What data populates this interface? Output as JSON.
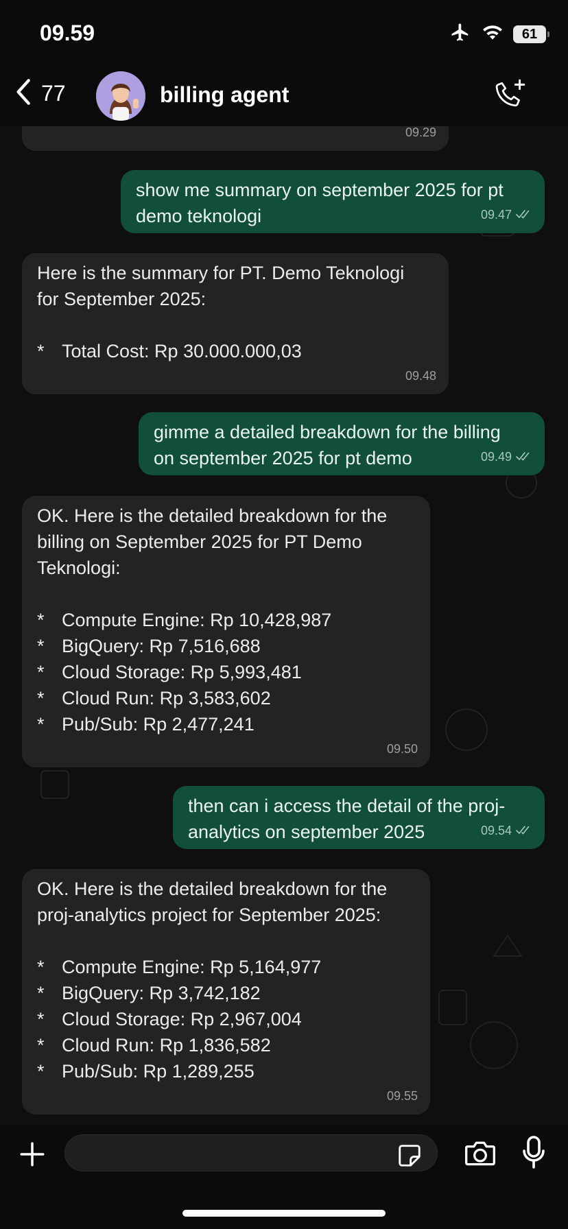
{
  "status": {
    "time": "09.59",
    "battery": "61"
  },
  "header": {
    "back_count": "77",
    "contact_name": "billing agent"
  },
  "messages": [
    {
      "dir": "in",
      "lines": [],
      "time": "09.29"
    },
    {
      "dir": "out",
      "lines": [
        "show me summary on september 2025 for pt",
        "demo teknologi"
      ],
      "time": "09.47"
    },
    {
      "dir": "in",
      "lines": [
        "Here is the summary for PT. Demo Teknologi",
        "for September 2025:",
        "",
        "*   Total Cost: Rp 30.000.000,03"
      ],
      "time": "09.48"
    },
    {
      "dir": "out",
      "lines": [
        "gimme a detailed breakdown for the billing",
        "on september 2025 for pt demo"
      ],
      "time": "09.49"
    },
    {
      "dir": "in",
      "lines": [
        "OK. Here is the detailed breakdown for the",
        "billing on September 2025 for PT Demo",
        "Teknologi:",
        "",
        "*   Compute Engine: Rp 10,428,987",
        "*   BigQuery: Rp 7,516,688",
        "*   Cloud Storage: Rp 5,993,481",
        "*   Cloud Run: Rp 3,583,602",
        "*   Pub/Sub: Rp 2,477,241"
      ],
      "time": "09.50"
    },
    {
      "dir": "out",
      "lines": [
        "then can i access the detail of the proj-",
        "analytics on september 2025"
      ],
      "time": "09.54"
    },
    {
      "dir": "in",
      "lines": [
        "OK. Here is the detailed breakdown for the",
        "proj-analytics project for September 2025:",
        "",
        "*   Compute Engine: Rp 5,164,977",
        "*   BigQuery: Rp 3,742,182",
        "*   Cloud Storage: Rp 2,967,004",
        "*   Cloud Run: Rp 1,836,582",
        "*   Pub/Sub: Rp 1,289,255"
      ],
      "time": "09.55"
    }
  ],
  "input": {
    "placeholder": ""
  },
  "icons": {
    "airplane": "airplane-icon",
    "wifi": "wifi-icon",
    "battery": "battery-icon",
    "back": "chevron-left-icon",
    "call": "add-call-icon",
    "plus": "plus-icon",
    "sticker": "sticker-icon",
    "camera": "camera-icon",
    "mic": "microphone-icon",
    "read": "double-check-icon"
  },
  "colors": {
    "incoming_bubble": "#232323",
    "outgoing_bubble": "#114f3a",
    "background": "#0b0b0b"
  }
}
